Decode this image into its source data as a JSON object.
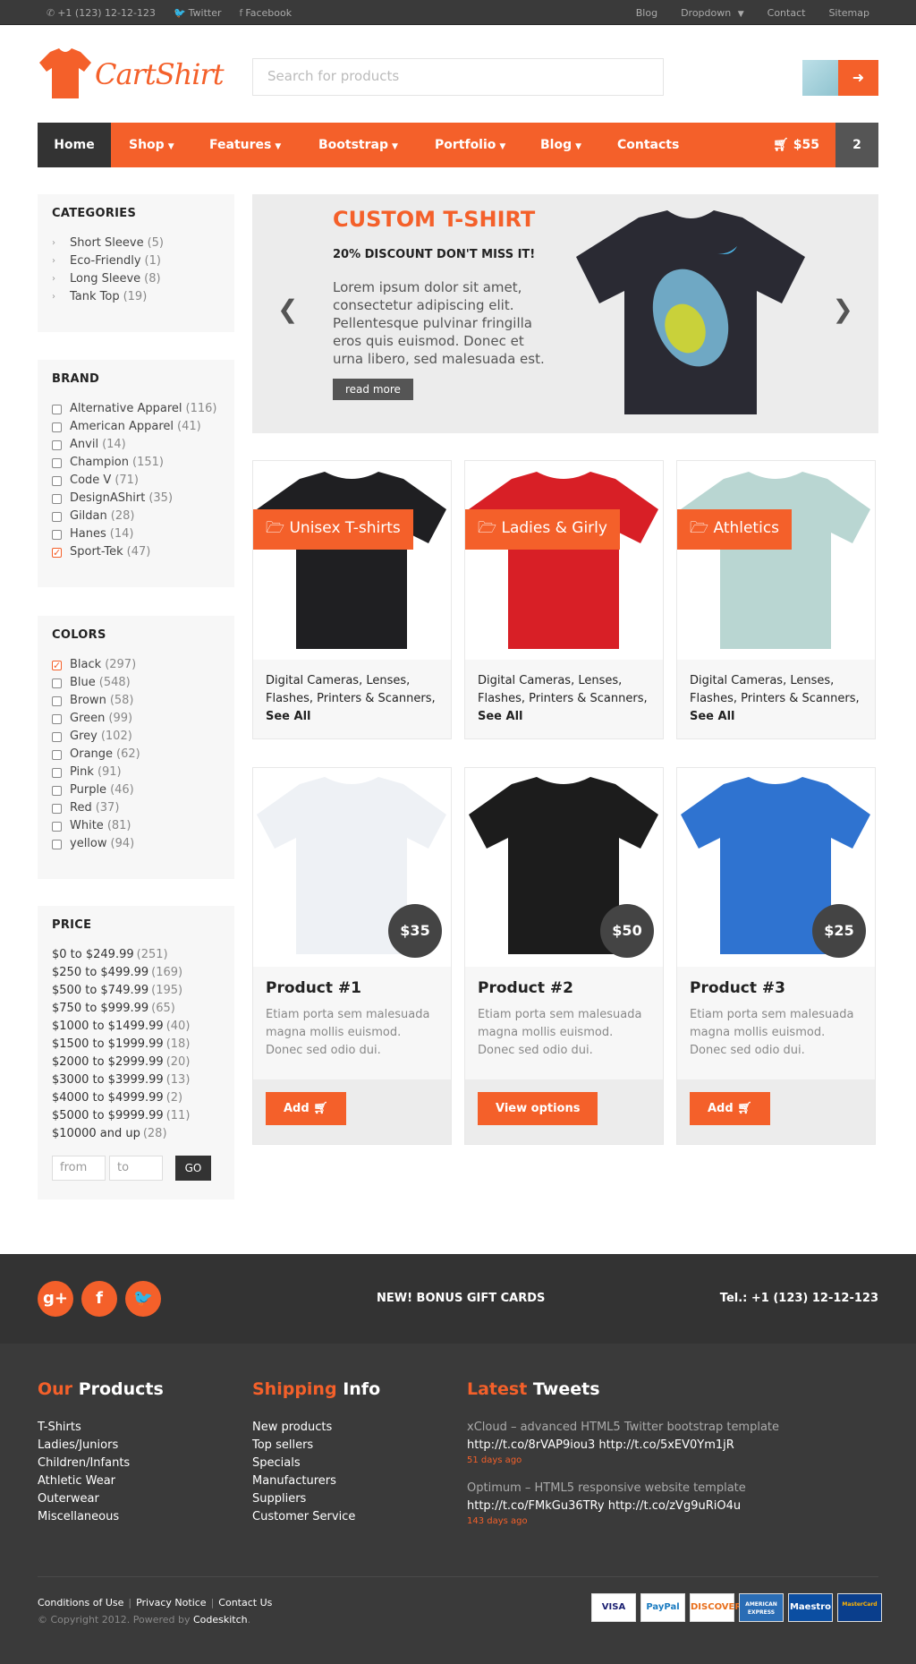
{
  "topbar": {
    "phone": "+1 (123) 12-12-123",
    "twitter": "Twitter",
    "facebook": "Facebook",
    "links": [
      "Blog",
      "Dropdown",
      "Contact",
      "Sitemap"
    ]
  },
  "header": {
    "logo_text": "CartShirt",
    "search_placeholder": "Search for products"
  },
  "nav": {
    "items": [
      "Home",
      "Shop",
      "Features",
      "Bootstrap",
      "Portfolio",
      "Blog",
      "Contacts"
    ],
    "cart_total": "$55",
    "cart_count": "2"
  },
  "categories": {
    "title": "CATEGORIES",
    "items": [
      {
        "label": "Short Sleeve",
        "count": "(5)"
      },
      {
        "label": "Eco-Friendly",
        "count": "(1)"
      },
      {
        "label": "Long Sleeve",
        "count": "(8)"
      },
      {
        "label": "Tank Top",
        "count": "(19)"
      }
    ]
  },
  "brand": {
    "title": "BRAND",
    "items": [
      {
        "label": "Alternative Apparel",
        "count": "(116)",
        "checked": false
      },
      {
        "label": "American Apparel",
        "count": "(41)",
        "checked": false
      },
      {
        "label": "Anvil",
        "count": "(14)",
        "checked": false
      },
      {
        "label": "Champion",
        "count": "(151)",
        "checked": false
      },
      {
        "label": "Code V",
        "count": "(71)",
        "checked": false
      },
      {
        "label": "DesignAShirt",
        "count": "(35)",
        "checked": false
      },
      {
        "label": "Gildan",
        "count": "(28)",
        "checked": false
      },
      {
        "label": "Hanes",
        "count": "(14)",
        "checked": false
      },
      {
        "label": "Sport-Tek",
        "count": "(47)",
        "checked": true
      }
    ]
  },
  "colors": {
    "title": "COLORS",
    "items": [
      {
        "label": "Black",
        "count": "(297)",
        "checked": true
      },
      {
        "label": "Blue",
        "count": "(548)",
        "checked": false
      },
      {
        "label": "Brown",
        "count": "(58)",
        "checked": false
      },
      {
        "label": "Green",
        "count": "(99)",
        "checked": false
      },
      {
        "label": "Grey",
        "count": "(102)",
        "checked": false
      },
      {
        "label": "Orange",
        "count": "(62)",
        "checked": false
      },
      {
        "label": "Pink",
        "count": "(91)",
        "checked": false
      },
      {
        "label": "Purple",
        "count": "(46)",
        "checked": false
      },
      {
        "label": "Red",
        "count": "(37)",
        "checked": false
      },
      {
        "label": "White",
        "count": "(81)",
        "checked": false
      },
      {
        "label": "yellow",
        "count": "(94)",
        "checked": false
      }
    ]
  },
  "price": {
    "title": "PRICE",
    "items": [
      {
        "label": "$0 to $249.99",
        "count": "(251)"
      },
      {
        "label": "$250 to $499.99",
        "count": "(169)"
      },
      {
        "label": "$500 to $749.99",
        "count": "(195)"
      },
      {
        "label": "$750 to $999.99",
        "count": "(65)"
      },
      {
        "label": "$1000 to $1499.99",
        "count": "(40)"
      },
      {
        "label": "$1500 to $1999.99",
        "count": "(18)"
      },
      {
        "label": "$2000 to $2999.99",
        "count": "(20)"
      },
      {
        "label": "$3000 to $3999.99",
        "count": "(13)"
      },
      {
        "label": "$4000 to $4999.99",
        "count": "(2)"
      },
      {
        "label": "$5000 to $9999.99",
        "count": "(11)"
      },
      {
        "label": "$10000 and up",
        "count": "(28)"
      }
    ],
    "from_placeholder": "from",
    "to_placeholder": "to",
    "go_label": "GO"
  },
  "slider": {
    "title": "CUSTOM T-SHIRT",
    "subtitle": "20% DISCOUNT DON'T MISS IT!",
    "text": "Lorem ipsum dolor sit amet, consectetur adipiscing elit. Pellentesque pulvinar fringilla eros quis euismod. Donec et urna libero, sed malesuada est.",
    "button": "read more"
  },
  "category_cards": [
    {
      "tag": "Unisex T-shirts",
      "shirt_color": "#1f1f22",
      "links": [
        "Digital Cameras",
        "Lenses",
        "Flashes",
        "Printers & Scanners"
      ],
      "see_all": "See All"
    },
    {
      "tag": "Ladies & Girly",
      "shirt_color": "#d81f26",
      "links": [
        "Digital Cameras",
        "Lenses",
        "Flashes",
        "Printers & Scanners"
      ],
      "see_all": "See All"
    },
    {
      "tag": "Athletics",
      "shirt_color": "#b9d6d2",
      "links": [
        "Digital Cameras",
        "Lenses",
        "Flashes",
        "Printers & Scanners"
      ],
      "see_all": "See All"
    }
  ],
  "products": [
    {
      "name": "Product #1",
      "price": "$35",
      "desc": "Etiam porta sem malesuada magna mollis euismod. Donec sed odio dui.",
      "button": "Add",
      "cart_icon": true,
      "shirt_color": "#eef1f5"
    },
    {
      "name": "Product #2",
      "price": "$50",
      "desc": "Etiam porta sem malesuada magna mollis euismod. Donec sed odio dui.",
      "button": "View options",
      "cart_icon": false,
      "shirt_color": "#1c1c1c"
    },
    {
      "name": "Product #3",
      "price": "$25",
      "desc": "Etiam porta sem malesuada magna mollis euismod. Donec sed odio dui.",
      "button": "Add",
      "cart_icon": true,
      "shirt_color": "#2f73d0"
    }
  ],
  "footer_bar": {
    "bonus": "NEW! BONUS GIFT CARDS",
    "tel": "Tel.: +1 (123) 12-12-123"
  },
  "footer": {
    "products_title_a": "Our",
    "products_title_b": "Products",
    "products": [
      "T-Shirts",
      "Ladies/Juniors",
      "Children/Infants",
      "Athletic Wear",
      "Outerwear",
      "Miscellaneous"
    ],
    "shipping_title_a": "Shipping",
    "shipping_title_b": "Info",
    "shipping": [
      "New products",
      "Top sellers",
      "Specials",
      "Manufacturers",
      "Suppliers",
      "Customer Service"
    ],
    "tweets_title_a": "Latest",
    "tweets_title_b": "Tweets",
    "tweets": [
      {
        "text": "xCloud – advanced HTML5 Twitter bootstrap template",
        "urls": "http://t.co/8rVAP9iou3 http://t.co/5xEV0Ym1jR",
        "ago": "51 days ago"
      },
      {
        "text": "Optimum – HTML5 responsive website template",
        "urls": "http://t.co/FMkGu36TRy http://t.co/zVg9uRiO4u",
        "ago": "143 days ago"
      }
    ],
    "bottom_links": [
      "Conditions of Use",
      "Privacy Notice",
      "Contact Us"
    ],
    "copyright": "© Copyright 2012. Powered by",
    "powered_by": "Codeskitch",
    "payments": [
      "VISA",
      "PayPal",
      "DISCOVER",
      "AMERICAN EXPRESS",
      "Maestro",
      "MasterCard"
    ]
  },
  "colors_theme": {
    "accent": "#f4602a",
    "dark": "#333333"
  }
}
